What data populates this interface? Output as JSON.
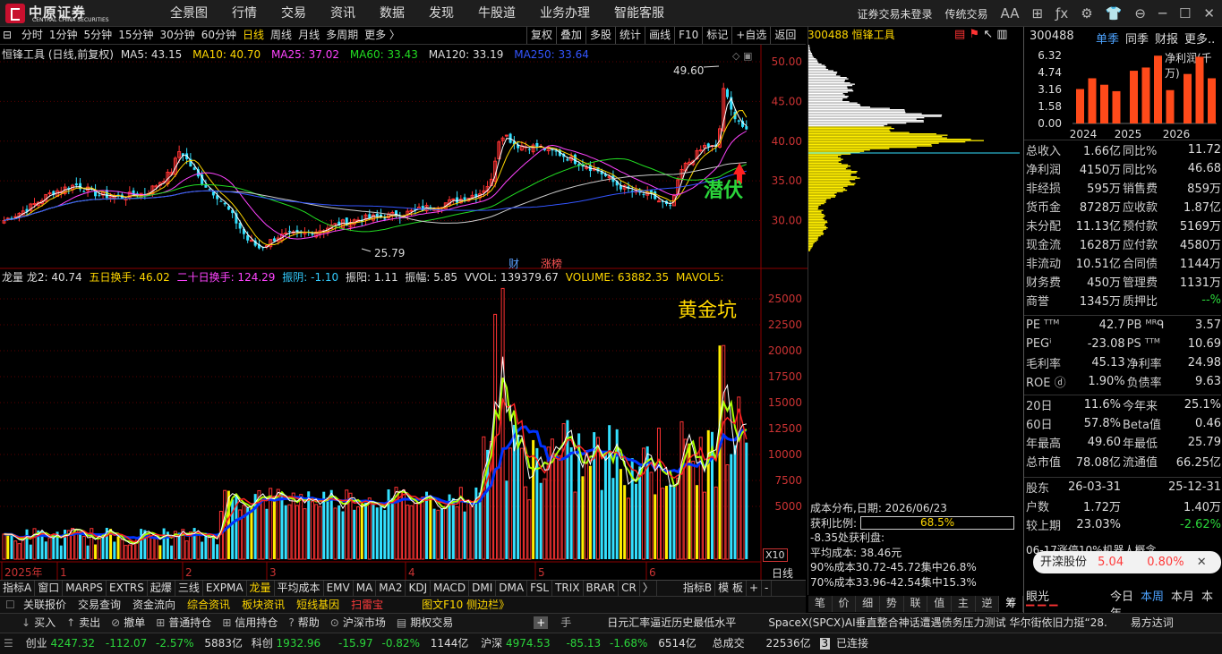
{
  "topbar": {
    "logo_cn": "中原证券",
    "logo_en": "CENTRAL CHINA SECURITIES",
    "nav": [
      "全景图",
      "行情",
      "交易",
      "资讯",
      "数据",
      "发现",
      "牛股道",
      "业务办理",
      "智能客服"
    ],
    "login_status": "证券交易未登录",
    "mode": "传统交易",
    "font_btn": "AA"
  },
  "toolbar": {
    "periods": [
      "分时",
      "1分钟",
      "5分钟",
      "15分钟",
      "30分钟",
      "60分钟",
      "日线",
      "周线",
      "月线",
      "多周期",
      "更多 〉"
    ],
    "active_period": "日线",
    "right_tools": [
      "复权",
      "叠加",
      "多股",
      "统计",
      "画线",
      "F10",
      "标记",
      "+自选",
      "返回"
    ]
  },
  "stock": {
    "code": "300488",
    "name": "恒锋工具"
  },
  "ma_line": {
    "title": "恒锋工具 (日线,前复权)",
    "ma5": "MA5: 43.15",
    "ma10": "MA10: 40.70",
    "ma25": "MA25: 37.02",
    "ma60": "MA60: 33.43",
    "ma120": "MA120: 33.19",
    "ma250": "MA250: 33.64"
  },
  "price_axis": [
    "50.00",
    "45.00",
    "40.00",
    "35.00",
    "30.00"
  ],
  "vol_axis": [
    "25000",
    "22500",
    "20000",
    "17500",
    "15000",
    "12500",
    "10000",
    "7500",
    "5000"
  ],
  "annotations": {
    "high": "49.60",
    "low": "25.79",
    "qianfu": "潜伏",
    "huangjinkeng": "黄金坑",
    "cai": "财",
    "zhangbang": "涨榜",
    "x10": "X10",
    "rixian": "日线"
  },
  "vol_line": {
    "title": "龙量",
    "long2": "龙2: 40.74",
    "wuri": "五日换手: 46.02",
    "ershiri": "二十日换手: 124.29",
    "zhenyin": "振阴: -1.10",
    "zhenyang": "振阳: 1.11",
    "zhenfu": "振幅: 5.85",
    "vvol": "VVOL: 139379.67",
    "volume": "VOLUME: 63882.35",
    "mavol": "MAVOL5:"
  },
  "time_axis": [
    "2025年",
    "1",
    "2",
    "3",
    "4",
    "5",
    "6"
  ],
  "bottom_tabs": [
    "指标A",
    "窗口",
    "MARPS",
    "EXTRS",
    "起爆",
    "三线",
    "EXPMA",
    "龙量",
    "平均成本",
    "EMV",
    "MA",
    "MA2",
    "KDJ",
    "MACD",
    "DMI",
    "DMA",
    "FSL",
    "TRIX",
    "BRAR",
    "CR",
    "〉",
    "指标B",
    "模 板",
    "+",
    "-"
  ],
  "active_tab": "龙量",
  "info_bar": [
    "关联报价",
    "交易查询",
    "资金流向",
    "综合资讯",
    "板块资讯",
    "短线基因",
    "扫雷宝",
    "图文F10 侧边栏》"
  ],
  "cost": {
    "date": "成本分布,日期: 2026/06/23",
    "ratio_label": "获利比例:",
    "ratio": "68.5%",
    "ratio_value": 0.685,
    "profit": "-8.35处获利盘:",
    "avg": "平均成本: 38.46元",
    "c90": "90%成本30.72-45.72集中26.8%",
    "c70": "70%成本33.96-42.54集中15.3%"
  },
  "mid_tabs": [
    "笔",
    "价",
    "细",
    "势",
    "联",
    "值",
    "主",
    "逆",
    "筹"
  ],
  "right": {
    "code": "300488",
    "tabs": [
      "单季",
      "同季",
      "财报",
      "更多.."
    ],
    "chart_title": "净利润(千万)",
    "chart_yaxis": [
      "6.32",
      "4.74",
      "3.16",
      "1.58",
      "0.00"
    ],
    "chart_data": {
      "type": "bar",
      "categories": [
        "2024",
        "2025",
        "2026"
      ],
      "values": [
        3.2,
        4.2,
        3.6,
        3.0,
        4.9,
        5.2,
        6.3,
        3.1,
        4.6,
        6.2,
        4.2
      ],
      "ylim": [
        0,
        6.32
      ]
    },
    "fin": [
      [
        "总收入",
        "1.66亿",
        "同比%",
        "11.72"
      ],
      [
        "净利润",
        "4150万",
        "同比%",
        "46.68"
      ],
      [
        "非经损",
        "595万",
        "销售费",
        "859万"
      ],
      [
        "货币金",
        "8728万",
        "应收款",
        "1.87亿"
      ],
      [
        "未分配",
        "11.13亿",
        "预付款",
        "5169万"
      ],
      [
        "现金流",
        "1628万",
        "应付款",
        "4580万"
      ],
      [
        "非流动",
        "10.51亿",
        "合同债",
        "1144万"
      ],
      [
        "财务费",
        "450万",
        "管理费",
        "1131万"
      ],
      [
        "商誉",
        "1345万",
        "质押比",
        "--%"
      ]
    ],
    "valuation": [
      [
        "PE ᵀᵀᴹ",
        "42.7",
        "PB ᴹᴿᑫ",
        "3.57"
      ],
      [
        "PEGⁱ",
        "-23.08",
        "PS ᵀᵀᴹ",
        "10.69"
      ],
      [
        "毛利率",
        "45.13",
        "净利率",
        "24.98"
      ],
      [
        "ROE ⓓ",
        "1.90%",
        "负债率",
        "9.63"
      ]
    ],
    "perf": [
      [
        "20日",
        "11.6%",
        "今年来",
        "25.1%"
      ],
      [
        "60日",
        "57.8%",
        "Beta值",
        "0.46"
      ],
      [
        "年最高",
        "49.60",
        "年最低",
        "25.79"
      ],
      [
        "总市值",
        "78.08亿",
        "流通值",
        "66.25亿"
      ]
    ],
    "holders": [
      [
        "股东",
        "26-03-31",
        "25-12-31"
      ],
      [
        "户数",
        "1.72万",
        "1.40万"
      ],
      [
        "较上期",
        "23.03%",
        "-2.62%"
      ]
    ],
    "news": "06-17涨停10%机器人概念",
    "popup": {
      "name": "开滦股份",
      "price": "5.04",
      "pct": "0.80%"
    },
    "bottom": {
      "label": "眼光",
      "tabs": [
        "今日",
        "本周",
        "本月",
        "本年"
      ],
      "active": "本周"
    }
  },
  "action_bar": [
    "买入",
    "卖出",
    "撤单",
    "普通持仓",
    "信用持仓",
    "帮助",
    "沪深市场",
    "期权交易",
    "日元汇率逼近历史最低水平",
    "SpaceX(SPCX)AI垂直整合神话遭遇债务压力测试 华尔街依旧力挺“28.",
    "易方达词"
  ],
  "status": {
    "cy_label": "创业",
    "cy": "4247.32",
    "cy_chg": "-112.07",
    "cy_pct": "-2.57%",
    "cy_amt": "5883亿",
    "kc_label": "科创",
    "kc": "1932.96",
    "kc_chg": "-15.97",
    "kc_pct": "-0.82%",
    "kc_amt": "1144亿",
    "hs_label": "沪深",
    "hs": "4974.53",
    "hs_chg": "-85.13",
    "hs_pct": "-1.68%",
    "hs_amt": "6514亿",
    "cj_label": "总成交",
    "cj": "22536亿",
    "login": "已连接",
    "num": "3"
  }
}
